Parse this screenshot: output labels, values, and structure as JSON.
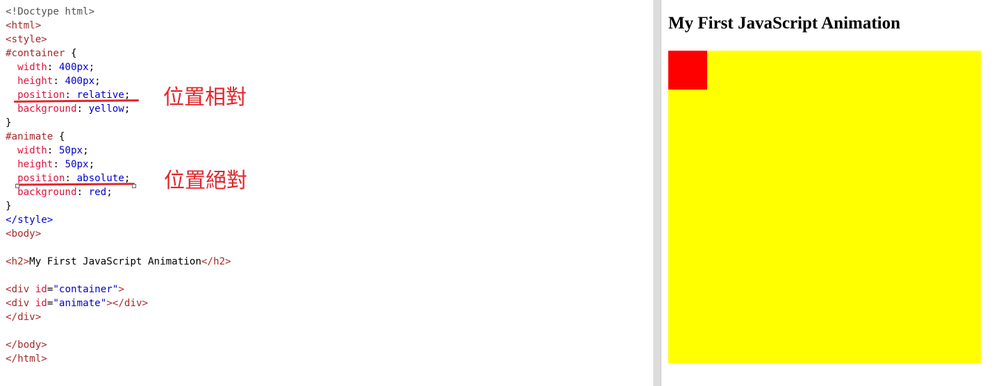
{
  "editor": {
    "lines": [
      [
        {
          "c": "t-doc",
          "t": "<!Doctype html>"
        }
      ],
      [
        {
          "c": "t-tag",
          "t": "<html>"
        }
      ],
      [
        {
          "c": "t-tag",
          "t": "<style>"
        }
      ],
      [
        {
          "c": "t-sel",
          "t": "#container"
        },
        {
          "c": "t-punc",
          "t": " {"
        }
      ],
      [
        {
          "c": "t-prop",
          "t": "  width"
        },
        {
          "c": "t-punc",
          "t": ": "
        },
        {
          "c": "t-val",
          "t": "400px"
        },
        {
          "c": "t-punc",
          "t": ";"
        }
      ],
      [
        {
          "c": "t-prop",
          "t": "  height"
        },
        {
          "c": "t-punc",
          "t": ": "
        },
        {
          "c": "t-val",
          "t": "400px"
        },
        {
          "c": "t-punc",
          "t": ";"
        }
      ],
      [
        {
          "c": "t-prop",
          "t": "  position"
        },
        {
          "c": "t-punc",
          "t": ": "
        },
        {
          "c": "t-val",
          "t": "relative"
        },
        {
          "c": "t-punc",
          "t": ";"
        }
      ],
      [
        {
          "c": "t-prop",
          "t": "  background"
        },
        {
          "c": "t-punc",
          "t": ": "
        },
        {
          "c": "t-val",
          "t": "yellow"
        },
        {
          "c": "t-punc",
          "t": ";"
        }
      ],
      [
        {
          "c": "t-punc",
          "t": "}"
        }
      ],
      [
        {
          "c": "t-sel",
          "t": "#animate"
        },
        {
          "c": "t-punc",
          "t": " {"
        }
      ],
      [
        {
          "c": "t-prop",
          "t": "  width"
        },
        {
          "c": "t-punc",
          "t": ": "
        },
        {
          "c": "t-val",
          "t": "50px"
        },
        {
          "c": "t-punc",
          "t": ";"
        }
      ],
      [
        {
          "c": "t-prop",
          "t": "  height"
        },
        {
          "c": "t-punc",
          "t": ": "
        },
        {
          "c": "t-val",
          "t": "50px"
        },
        {
          "c": "t-punc",
          "t": ";"
        }
      ],
      [
        {
          "c": "t-prop",
          "t": "  position"
        },
        {
          "c": "t-punc",
          "t": ": "
        },
        {
          "c": "t-val",
          "t": "absolute"
        },
        {
          "c": "t-punc",
          "t": ";"
        }
      ],
      [
        {
          "c": "t-prop",
          "t": "  background"
        },
        {
          "c": "t-punc",
          "t": ": "
        },
        {
          "c": "t-val",
          "t": "red"
        },
        {
          "c": "t-punc",
          "t": ";"
        }
      ],
      [
        {
          "c": "t-punc",
          "t": "}"
        }
      ],
      [
        {
          "c": "t-tag2",
          "t": "</style>"
        }
      ],
      [
        {
          "c": "t-tag",
          "t": "<body>"
        }
      ],
      [],
      [
        {
          "c": "t-tag",
          "t": "<h2>"
        },
        {
          "c": "t-text",
          "t": "My First JavaScript Animation"
        },
        {
          "c": "t-tag",
          "t": "</h2>"
        }
      ],
      [],
      [
        {
          "c": "t-tag",
          "t": "<div "
        },
        {
          "c": "t-attr",
          "t": "id"
        },
        {
          "c": "t-punc",
          "t": "="
        },
        {
          "c": "t-val",
          "t": "\"container\""
        },
        {
          "c": "t-tag",
          "t": ">"
        }
      ],
      [
        {
          "c": "t-tag",
          "t": "<div "
        },
        {
          "c": "t-attr",
          "t": "id"
        },
        {
          "c": "t-punc",
          "t": "="
        },
        {
          "c": "t-val",
          "t": "\"animate\""
        },
        {
          "c": "t-tag",
          "t": "></div>"
        }
      ],
      [
        {
          "c": "t-tag",
          "t": "</div>"
        }
      ],
      [],
      [
        {
          "c": "t-tag",
          "t": "</body>"
        }
      ],
      [
        {
          "c": "t-tag",
          "t": "</html>"
        }
      ]
    ]
  },
  "annotations": {
    "relative_note": "位置相對",
    "absolute_note": "位置絕對"
  },
  "result": {
    "title": "My First JavaScript Animation",
    "container_color": "#ffff00",
    "animate_color": "#ff0000"
  },
  "colors": {
    "annotation": "#e0262c"
  }
}
